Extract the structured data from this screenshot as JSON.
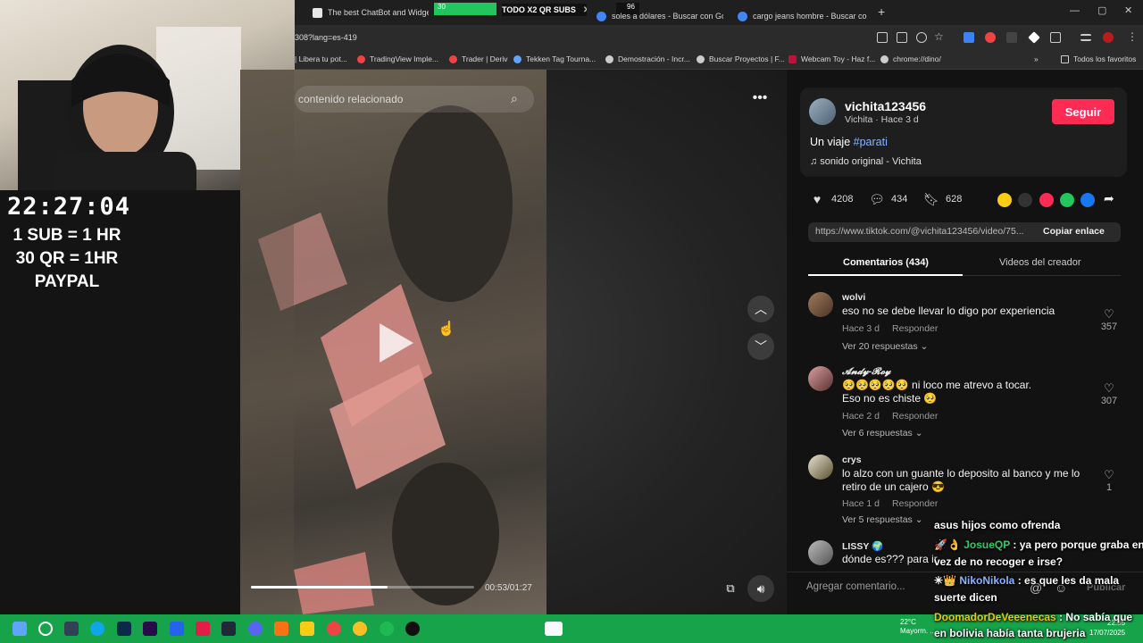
{
  "browser": {
    "tabs": [
      {
        "label": "The best ChatBot and Widgets",
        "color": "#e6e6e6"
      },
      {
        "label": "TODO X2 QR SUBS",
        "color": "#2ecc71"
      },
      {
        "label": "soles a dólares - Buscar con Go",
        "color": "#4285f4"
      },
      {
        "label": "cargo jeans hombre - Buscar con",
        "color": "#4285f4"
      }
    ],
    "new_tab": "+",
    "address": "308?lang=es-419",
    "bookmarks": [
      "| Libera tu pot...",
      "TradingView Imple...",
      "Trader | Deriv",
      "Tekken Tag Tourna...",
      "Demostración - Incr...",
      "Buscar Proyectos | F...",
      "Webcam Toy - Haz f...",
      "chrome://dino/"
    ],
    "all_favorites": "Todos los favoritos",
    "overlay_badge": "30",
    "overlay_badge_2": "96"
  },
  "stream": {
    "timer": "22:27:04",
    "rules": [
      "1 SUB = 1 HR",
      "30 QR = 1HR",
      "PAYPAL"
    ]
  },
  "video": {
    "search_placeholder": "contenido relacionado",
    "time": "00:53/01:27",
    "progress_fraction": 0.61
  },
  "post": {
    "username": "vichita123456",
    "subline": "Vichita · Hace 3 d",
    "follow_label": "Seguir",
    "caption": "Un viaje ",
    "hashtag": "#parati",
    "sound": "♫  sonido original - Vichita",
    "likes": "4208",
    "comments": "434",
    "saves": "628",
    "link": "https://www.tiktok.com/@vichita123456/video/75...",
    "copy_label": "Copiar enlace",
    "tab_comments": "Comentarios (434)",
    "tab_creator": "Videos del creador"
  },
  "comments": [
    {
      "name": "wolvi",
      "text": "eso no se debe llevar lo digo por experiencia",
      "meta": "Hace 3 d",
      "reply": "Responder",
      "replies": "Ver 20 respuestas",
      "likes": "357"
    },
    {
      "name": "𝓐𝓷𝓭𝔂-𝓡𝓸𝔂",
      "text": "🥺🥺🥺🥺🥺 ni loco me atrevo a tocar.\nEso no es chiste 🥺",
      "meta": "Hace 2 d",
      "reply": "Responder",
      "replies": "Ver 6 respuestas",
      "likes": "307"
    },
    {
      "name": "crys",
      "text": "lo alzo con un guante lo deposito al banco y me lo retiro de un cajero 😎",
      "meta": "Hace 1 d",
      "reply": "Responder",
      "replies": "Ver 5 respuestas",
      "likes": "1"
    },
    {
      "name": "LISSY 🌍",
      "text": "dónde es??? para ir",
      "meta": "",
      "reply": "",
      "replies": "",
      "likes": ""
    }
  ],
  "comment_input": {
    "placeholder": "Agregar comentario...",
    "publish": "Publicar"
  },
  "chat": [
    {
      "user": "",
      "text": "asus hijos como ofrenda"
    },
    {
      "user": "JosueQP",
      "text": ": ya pero porque graba en"
    },
    {
      "user": "",
      "text": "vez de no recoger e irse?"
    },
    {
      "user": "NikoNikola",
      "text": ": es que les da mala"
    },
    {
      "user": "",
      "text": "suerte dicen"
    },
    {
      "user": "DoomadorDeVeeenecas",
      "text": ": No sabía que"
    },
    {
      "user": "",
      "text": "en bolivia había tanta brujeria"
    }
  ],
  "taskbar": {
    "weather_temp": "22°C",
    "weather_desc": "Mayorm. ...",
    "time": "22:35",
    "date": "17/07/2025"
  }
}
